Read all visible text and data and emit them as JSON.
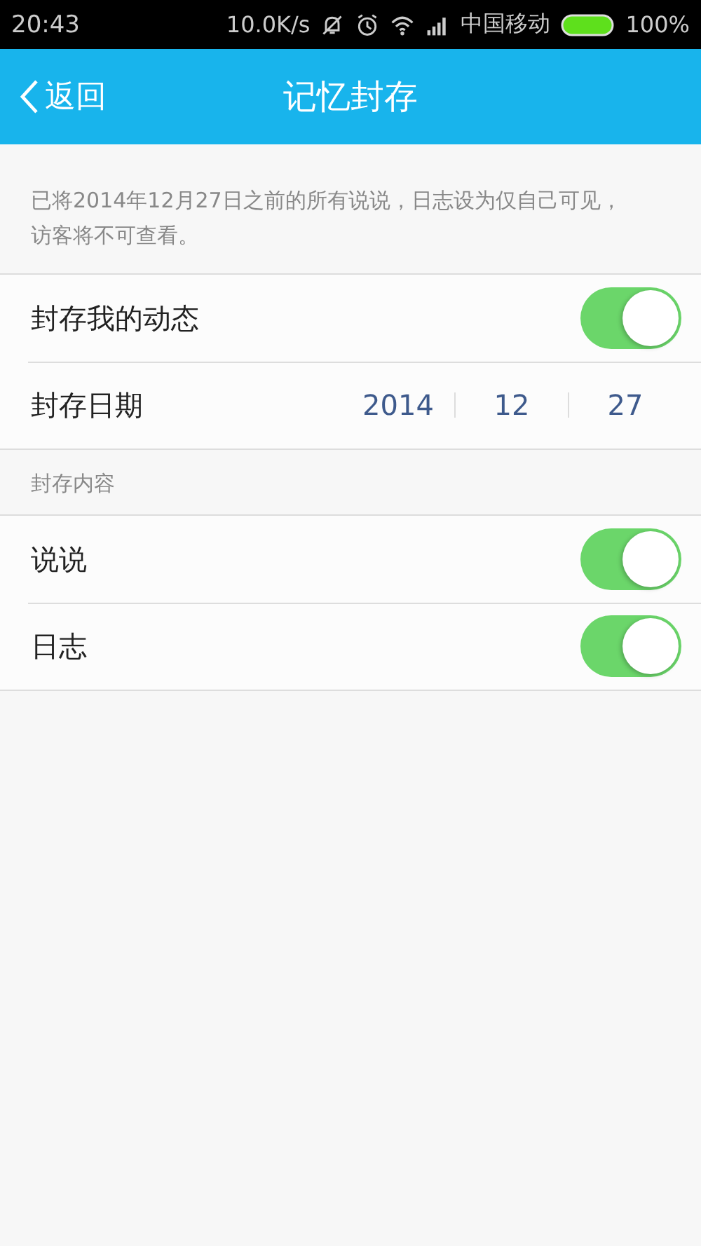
{
  "status_bar": {
    "time": "20:43",
    "network_speed": "10.0K/s",
    "carrier": "中国移动",
    "battery": "100%"
  },
  "header": {
    "back_label": "返回",
    "title": "记忆封存"
  },
  "notice": "已将2014年12月27日之前的所有说说，日志设为仅自己可见，访客将不可查看。",
  "settings": [
    {
      "kind": "toggle",
      "label": "封存我的动态",
      "on": true
    },
    {
      "kind": "date",
      "label": "封存日期",
      "parts": [
        "2014",
        "12",
        "27"
      ]
    }
  ],
  "section_title": "封存内容",
  "content_items": [
    {
      "label": "说说",
      "on": true
    },
    {
      "label": "日志",
      "on": true
    }
  ]
}
